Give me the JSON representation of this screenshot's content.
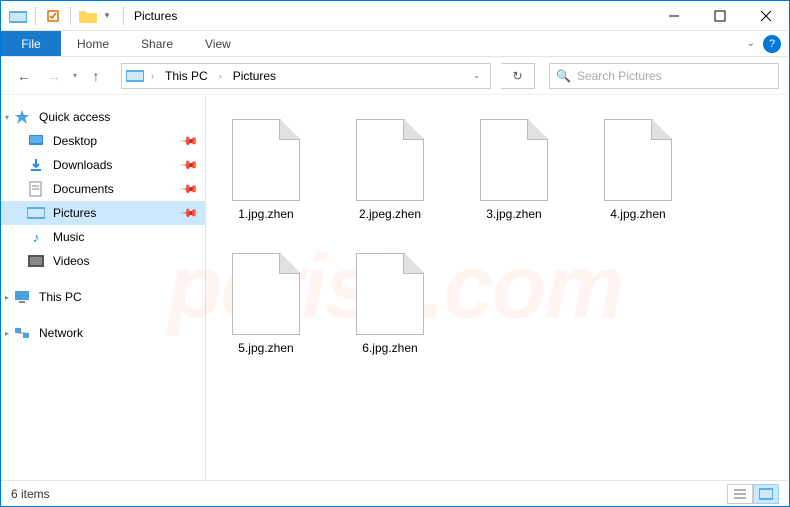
{
  "window": {
    "title": "Pictures"
  },
  "ribbon": {
    "file": "File",
    "tabs": [
      "Home",
      "Share",
      "View"
    ]
  },
  "breadcrumb": {
    "items": [
      "This PC",
      "Pictures"
    ]
  },
  "search": {
    "placeholder": "Search Pictures"
  },
  "sidebar": {
    "quick_access": "Quick access",
    "pinned": [
      {
        "label": "Desktop"
      },
      {
        "label": "Downloads"
      },
      {
        "label": "Documents"
      },
      {
        "label": "Pictures"
      }
    ],
    "libs": [
      {
        "label": "Music"
      },
      {
        "label": "Videos"
      }
    ],
    "this_pc": "This PC",
    "network": "Network"
  },
  "files": [
    {
      "name": "1.jpg.zhen"
    },
    {
      "name": "2.jpeg.zhen"
    },
    {
      "name": "3.jpg.zhen"
    },
    {
      "name": "4.jpg.zhen"
    },
    {
      "name": "5.jpg.zhen"
    },
    {
      "name": "6.jpg.zhen"
    }
  ],
  "status": {
    "count": "6 items"
  }
}
